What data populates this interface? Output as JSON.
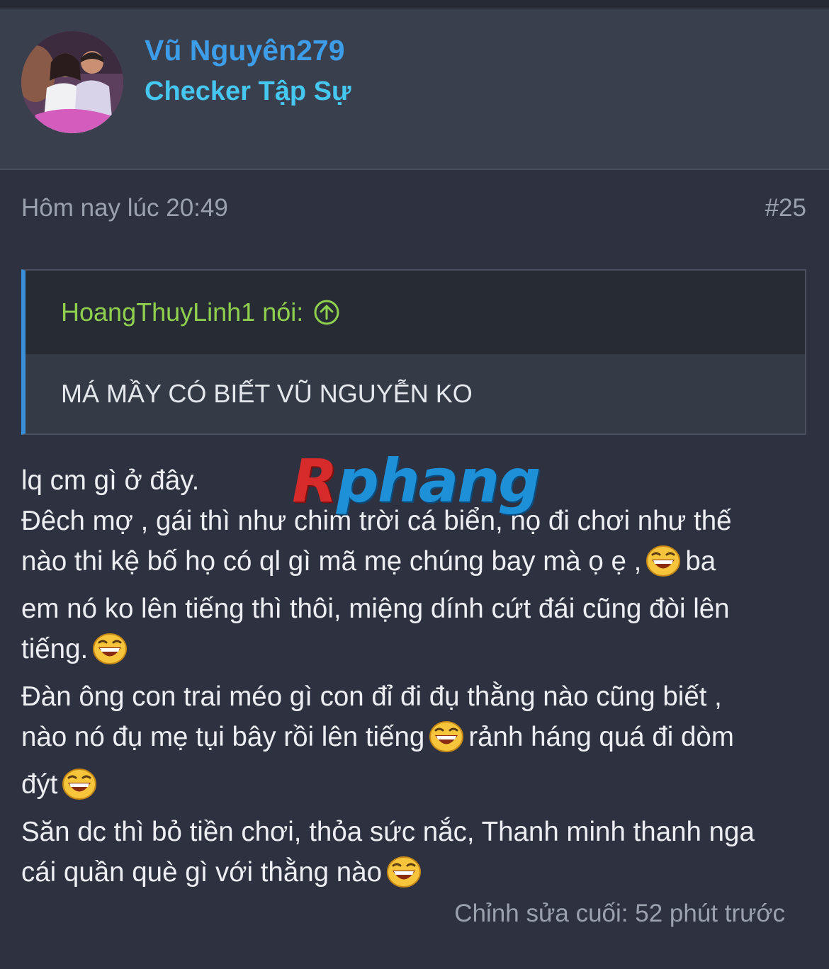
{
  "post": {
    "author": "Vũ Nguyên279",
    "rank": "Checker Tập Sự",
    "timestamp": "Hôm nay lúc 20:49",
    "post_number": "#25",
    "quote": {
      "author_line": "HoangThuyLinh1 nói:",
      "text": "MÁ MẦY CÓ BIẾT VŨ NGUYỄN KO"
    },
    "body_lines": [
      {
        "text": "lq cm gì ở đây.",
        "emoji": false,
        "after": ""
      },
      {
        "text": "Đêch mợ , gái thì như chim trời cá biển, họ đi chơi như thế",
        "emoji": false,
        "after": ""
      },
      {
        "text": "nào thi kệ bố họ có ql gì mã mẹ chúng bay mà ọ ẹ ,",
        "emoji": true,
        "after": "ba"
      },
      {
        "text": "em nó ko lên tiếng thì thôi, miệng dính cứt đái cũng đòi lên",
        "emoji": false,
        "after": ""
      },
      {
        "text": "tiếng.",
        "emoji": true,
        "after": ""
      },
      {
        "text": "Đàn ông con trai méo gì con đỉ đi đụ thằng nào cũng biết ,",
        "emoji": false,
        "after": ""
      },
      {
        "text": "nào nó đụ mẹ tụi bây rồi lên tiếng",
        "emoji": true,
        "after": "rảnh háng quá đi dòm"
      },
      {
        "text": "đýt",
        "emoji": true,
        "after": ""
      },
      {
        "text": "Săn dc thì bỏ tiền chơi, thỏa sức nắc, Thanh minh thanh nga",
        "emoji": false,
        "after": ""
      },
      {
        "text": "cái quần què gì với thằng nào",
        "emoji": true,
        "after": ""
      }
    ],
    "emoji_icon": "laughing-emoji-icon",
    "edited": "Chỉnh sửa cuối: 52 phút trước"
  },
  "watermark": {
    "part1": "R",
    "part2": "phang"
  },
  "colors": {
    "background": "#2e3240",
    "header": "#3a3f4d",
    "username": "#3d9de8",
    "rank": "#46c7f0",
    "quote_author": "#8fd14f",
    "quote_border": "#3b8fd9"
  }
}
